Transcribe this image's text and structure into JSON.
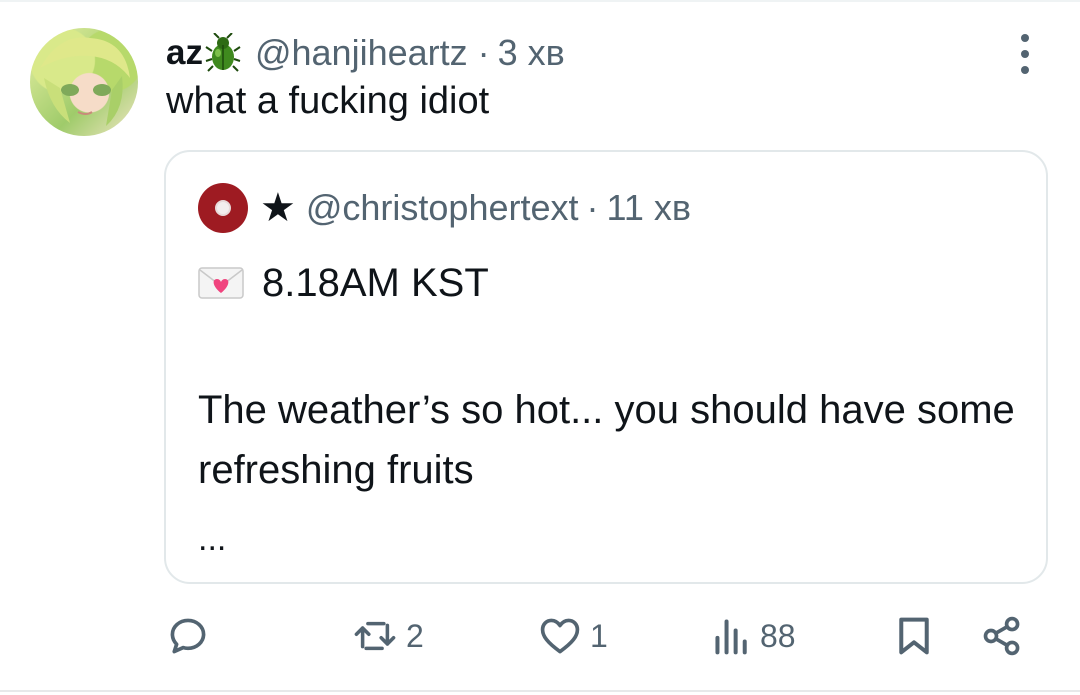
{
  "tweet": {
    "author_name": "az",
    "author_handle": "@hanjiheartz",
    "time": "3 хв",
    "text": "what a fucking idiot"
  },
  "quote": {
    "author_name": "★",
    "author_handle": "@christophertext",
    "time": "11 хв",
    "line1": "8.18AM KST",
    "body": "The weather’s so hot... you should have some refreshing fruits",
    "ellipsis": "..."
  },
  "separator": "·",
  "actions": {
    "reply_count": "",
    "retweet_count": "2",
    "like_count": "1",
    "views_count": "88"
  },
  "icons": {
    "author_emoji": "beetle-icon",
    "quote_prefix": "love-letter-icon",
    "more": "more-options-icon",
    "reply": "reply-icon",
    "retweet": "retweet-icon",
    "like": "heart-icon",
    "views": "views-icon",
    "bookmark": "bookmark-icon",
    "share": "share-icon"
  },
  "colors": {
    "text": "#0f1419",
    "secondary": "#536471",
    "quote_border": "#e2e8ea",
    "quote_avatar": "#9e1b22"
  }
}
